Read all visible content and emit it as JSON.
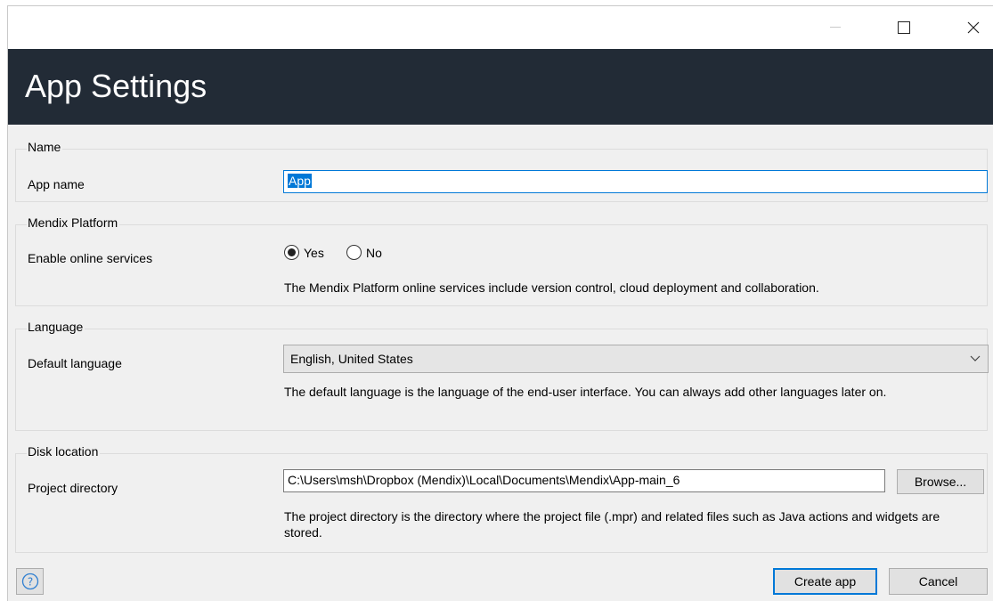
{
  "window": {
    "title": "App Settings",
    "controls": {
      "minimize": "minimize-icon",
      "maximize": "maximize-icon",
      "close": "close-icon"
    }
  },
  "sections": {
    "name": {
      "legend": "Name",
      "app_name_label": "App name",
      "app_name_value": "App"
    },
    "platform": {
      "legend": "Mendix Platform",
      "online_label": "Enable online services",
      "yes_label": "Yes",
      "no_label": "No",
      "selected": "Yes",
      "description": "The Mendix Platform online services include version control, cloud deployment and collaboration."
    },
    "language": {
      "legend": "Language",
      "default_label": "Default language",
      "selected_value": "English, United States",
      "description": "The default language is the language of the end-user interface. You can always add other languages later on."
    },
    "disk": {
      "legend": "Disk location",
      "dir_label": "Project directory",
      "dir_value": "C:\\Users\\msh\\Dropbox (Mendix)\\Local\\Documents\\Mendix\\App-main_6",
      "browse_label": "Browse...",
      "description": "The project directory is the directory where the project file (.mpr) and related files such as Java actions and widgets are stored."
    }
  },
  "footer": {
    "help_icon": "help-icon",
    "create_label": "Create app",
    "cancel_label": "Cancel"
  },
  "colors": {
    "header_bg": "#222b36",
    "accent": "#0078d7",
    "window_bg": "#f0f0f0"
  }
}
